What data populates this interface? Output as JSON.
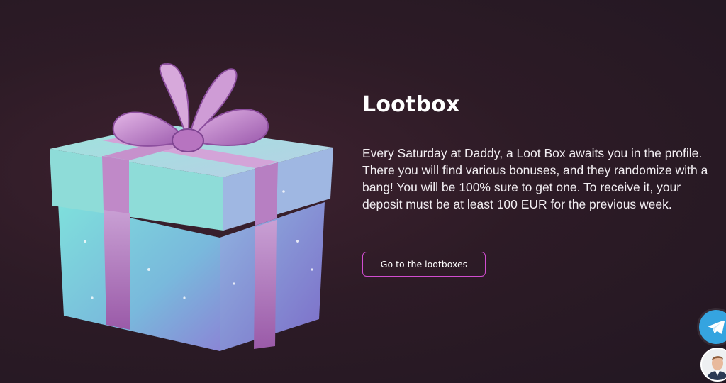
{
  "promo": {
    "title": "Lootbox",
    "description": "Every Saturday at Daddy, a Loot Box awaits you in the profile. There you will find various bonuses, and they randomize with a bang! You will be 100% sure to get one. To receive it, your deposit must be at least 100 EUR for the previous week.",
    "cta_label": "Go to the lootboxes"
  },
  "icons": {
    "gift": "gift-box-illustration",
    "telegram": "telegram-icon",
    "support": "support-avatar"
  },
  "colors": {
    "background": "#2d1b26",
    "cta_border": "#d14dd0",
    "telegram": "#35a4e0",
    "box_teal": "#7fd3d6",
    "ribbon_pink": "#b47bb8"
  }
}
